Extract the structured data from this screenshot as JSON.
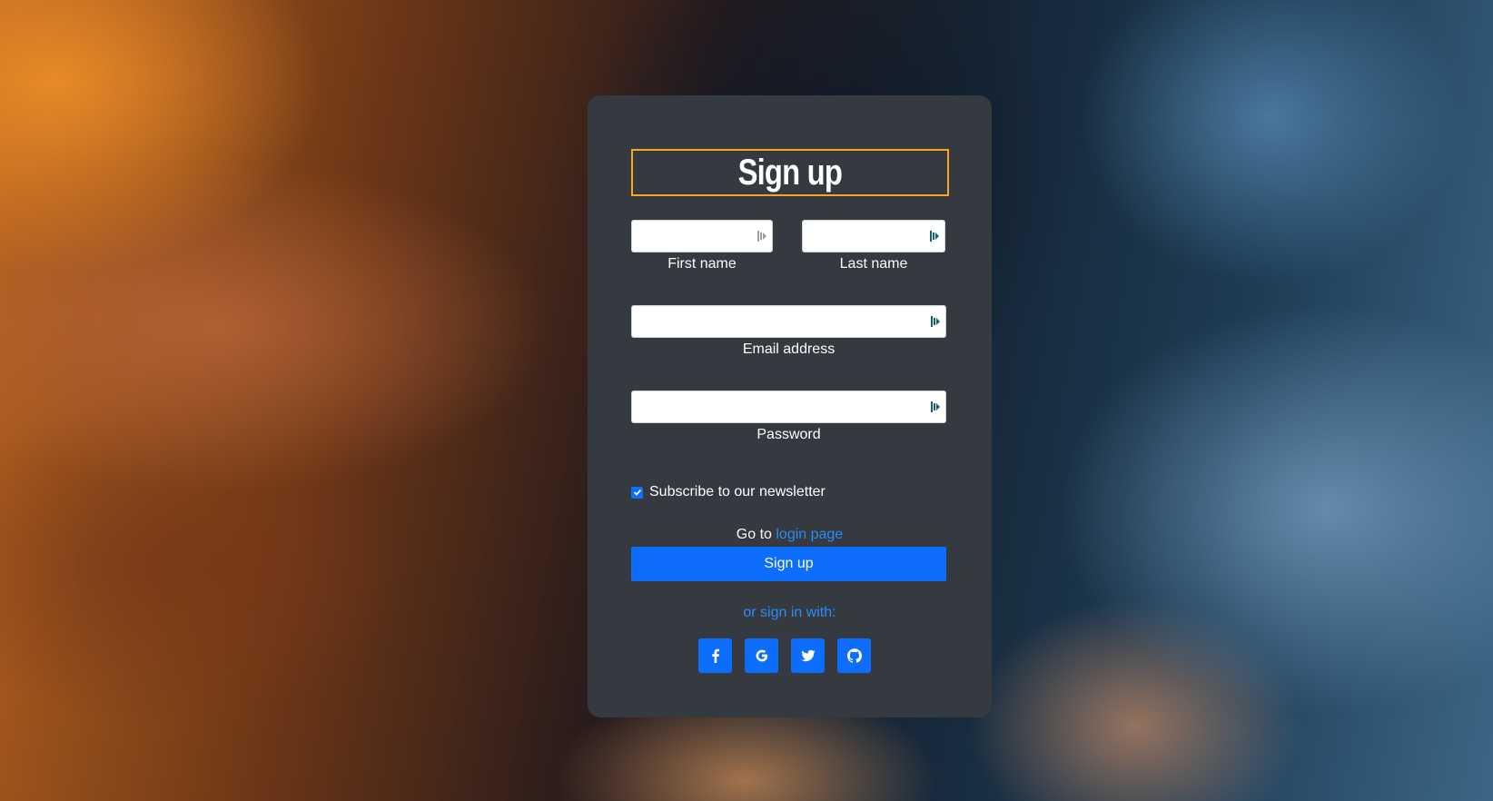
{
  "form": {
    "title": "Sign up",
    "first_name": {
      "label": "First name",
      "value": ""
    },
    "last_name": {
      "label": "Last name",
      "value": ""
    },
    "email": {
      "label": "Email address",
      "value": ""
    },
    "password": {
      "label": "Password",
      "value": ""
    },
    "newsletter": {
      "label": "Subscribe to our newsletter",
      "checked": true
    },
    "goto_prefix": "Go to ",
    "goto_link": "login page",
    "submit_label": "Sign up",
    "social_prompt": "or sign in with:"
  },
  "social_buttons": [
    "facebook-icon",
    "google-icon",
    "twitter-icon",
    "github-icon"
  ],
  "colors": {
    "card": "#343a40",
    "accent": "#0d6efd",
    "title_border": "#f5a623",
    "link": "#2b8cf5"
  }
}
